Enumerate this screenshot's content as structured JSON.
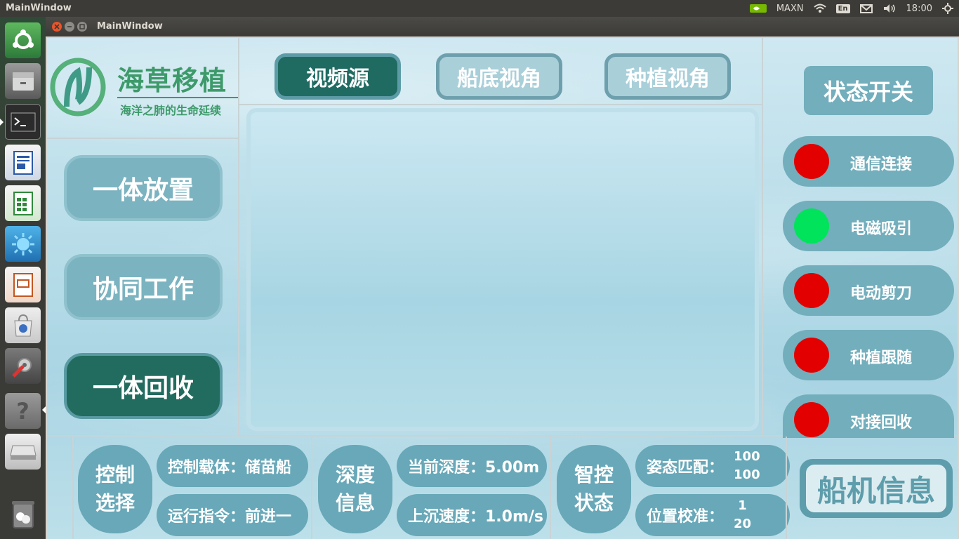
{
  "system": {
    "app_title": "MainWindow",
    "gpu_label": "MAXN",
    "keyboard": "En",
    "clock": "18:00"
  },
  "window": {
    "title": "MainWindow"
  },
  "logo": {
    "title": "海草移植",
    "subtitle": "海洋之肺的生命延续"
  },
  "left_buttons": [
    {
      "label": "一体放置"
    },
    {
      "label": "协同工作"
    },
    {
      "label": "一体回收"
    }
  ],
  "tabs": [
    {
      "label": "视频源"
    },
    {
      "label": "船底视角"
    },
    {
      "label": "种植视角"
    }
  ],
  "status": {
    "title": "状态开关",
    "items": [
      {
        "label": "通信连接",
        "color": "#e30000"
      },
      {
        "label": "电磁吸引",
        "color": "#00e35a"
      },
      {
        "label": "电动剪刀",
        "color": "#e30000"
      },
      {
        "label": "种植跟随",
        "color": "#e30000"
      },
      {
        "label": "对接回收",
        "color": "#e30000"
      }
    ]
  },
  "bottom": {
    "control": {
      "title_line1": "控制",
      "title_line2": "选择",
      "carrier": "控制载体：储苗船",
      "command": "运行指令：前进一"
    },
    "depth": {
      "title_line1": "深度",
      "title_line2": "信息",
      "current": "当前深度：5.00m",
      "speed": "上沉速度：1.0m/s"
    },
    "smart": {
      "title_line1": "智控",
      "title_line2": "状态",
      "attitude_label": "姿态匹配：",
      "attitude_v1": "100",
      "attitude_v2": "100",
      "position_label": "位置校准：",
      "position_v1": "1",
      "position_v2": "20"
    },
    "ship_info": "船机信息"
  },
  "colors": {
    "accent_dark": "#1f6b61",
    "accent_light": "#73aebc",
    "led_off": "#e30000",
    "led_on": "#00e35a"
  }
}
